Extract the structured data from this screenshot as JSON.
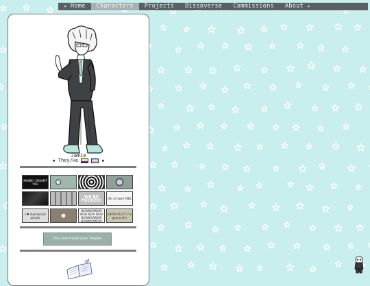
{
  "nav": {
    "items": [
      {
        "label": "Home",
        "active": false
      },
      {
        "label": "Characters",
        "active": true
      },
      {
        "label": "Projects",
        "active": false
      },
      {
        "label": "Dissoverse",
        "active": false
      },
      {
        "label": "Commissions",
        "active": false
      },
      {
        "label": "About",
        "active": false
      }
    ],
    "star_glyph": "✦"
  },
  "character": {
    "name": "Jamie",
    "pronouns": "They/He",
    "bullet": "▪"
  },
  "buttons": {
    "b1": "MAYBE I DREAMT YOU",
    "b2": "",
    "b3": "",
    "b4": "",
    "b5": "",
    "b6": "",
    "b7": "WE'RE FUCKED!",
    "b8": "this is how I FEEL",
    "b9": "I ♥ mechanical pencils",
    "b10": "",
    "b11": "NOWNOWNOW NOW NOW NOW NOWNOWNOW NOWNOWNOW",
    "b12": "ENTRY 913.5° I'm gonna die!"
  },
  "webring": {
    "text": "This user might pale. Maybe."
  },
  "colors": {
    "background": "#c8eeee",
    "nav_bg": "#5a5f62",
    "nav_active": "#aab0b2",
    "card_border": "#6f7375"
  }
}
